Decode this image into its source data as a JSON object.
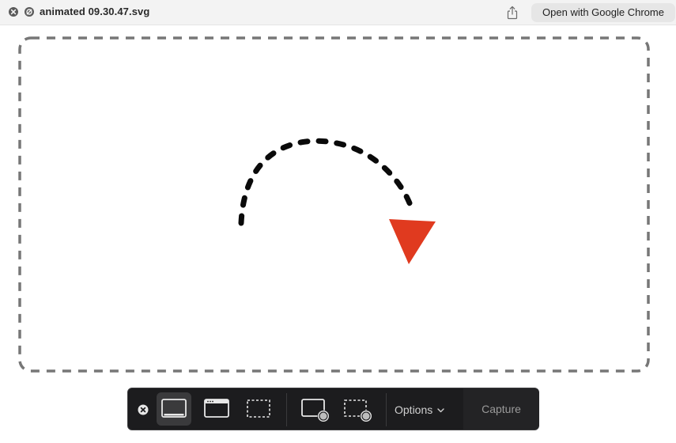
{
  "window": {
    "title": "animated 09.30.47.svg",
    "open_with_label": "Open with Google Chrome"
  },
  "icons": {
    "close": "close-icon",
    "hide": "hide-icon",
    "share": "share-icon"
  },
  "colors": {
    "arrow_head": "#e03a1f",
    "dashed_arc": "#0a0a0a",
    "selection_border": "#777777",
    "capture_bar_bg": "#1c1c1e"
  },
  "capture_bar": {
    "tools": [
      {
        "name": "capture-entire-screen",
        "selected": true
      },
      {
        "name": "capture-selected-window",
        "selected": false
      },
      {
        "name": "capture-selected-portion",
        "selected": false
      },
      {
        "name": "record-entire-screen",
        "selected": false
      },
      {
        "name": "record-selected-portion",
        "selected": false
      }
    ],
    "options_label": "Options",
    "capture_label": "Capture"
  }
}
